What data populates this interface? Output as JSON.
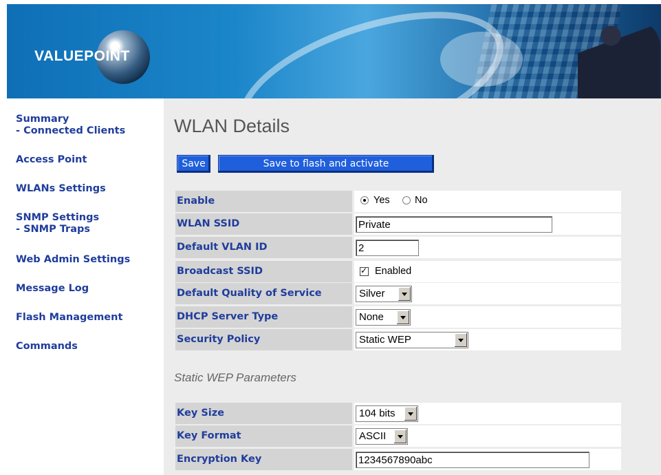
{
  "header": {
    "logo_text": "VALUEPOINT"
  },
  "sidebar": {
    "items": [
      {
        "label": "Summary",
        "sub": "- Connected Clients"
      },
      {
        "label": "Access Point"
      },
      {
        "label": "WLANs Settings"
      },
      {
        "label": "SNMP Settings",
        "sub": "- SNMP Traps"
      },
      {
        "label": "Web Admin Settings"
      },
      {
        "label": "Message Log"
      },
      {
        "label": "Flash Management"
      },
      {
        "label": "Commands"
      }
    ]
  },
  "main": {
    "title": "WLAN Details",
    "buttons": {
      "save": "Save",
      "save_flash": "Save to flash and activate"
    },
    "fields": {
      "enable": {
        "label": "Enable",
        "yes": "Yes",
        "no": "No",
        "selected": "Yes"
      },
      "ssid": {
        "label": "WLAN SSID",
        "value": "Private"
      },
      "vlan": {
        "label": "Default VLAN ID",
        "value": "2"
      },
      "broadcast": {
        "label": "Broadcast SSID",
        "checkbox_label": "Enabled",
        "checked": true
      },
      "qos": {
        "label": "Default Quality of Service",
        "value": "Silver"
      },
      "dhcp": {
        "label": "DHCP Server Type",
        "value": "None"
      },
      "security": {
        "label": "Security Policy",
        "value": "Static WEP"
      }
    },
    "wep_section_title": "Static WEP Parameters",
    "wep": {
      "key_size": {
        "label": "Key Size",
        "value": "104 bits"
      },
      "key_format": {
        "label": "Key Format",
        "value": "ASCII"
      },
      "encryption_key": {
        "label": "Encryption Key",
        "value": "1234567890abc"
      }
    }
  },
  "colors": {
    "nav_text": "#1f3d9c",
    "button_blue": "#1f5fdc",
    "label_bg": "#d4d4d4",
    "main_bg": "#ececec"
  }
}
